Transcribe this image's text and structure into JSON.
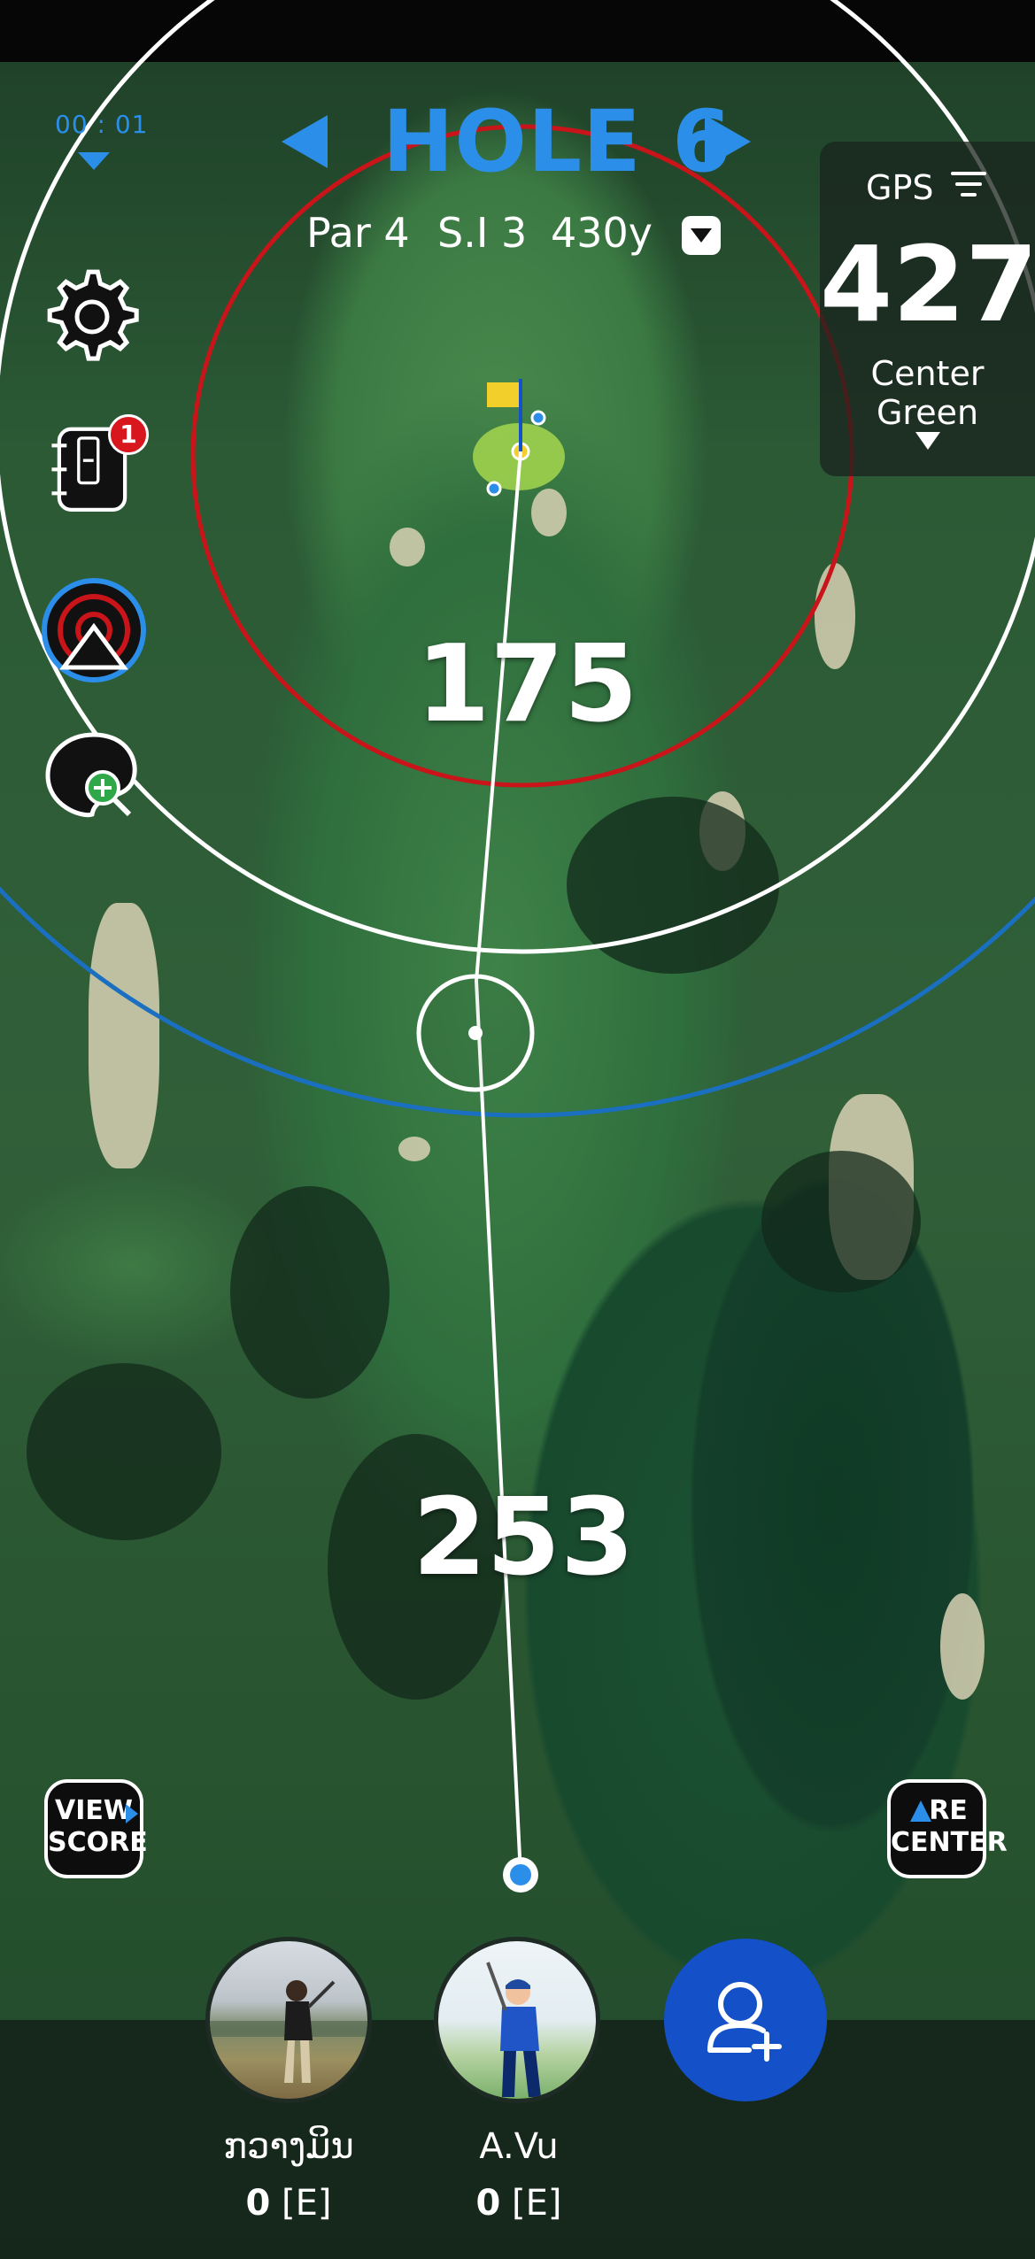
{
  "timer": {
    "value": "00 : 01"
  },
  "hole": {
    "title": "HOLE 6",
    "par": "Par 4",
    "stroke_index": "S.I 3",
    "yardage": "430y"
  },
  "gps": {
    "label": "GPS",
    "distance": "427",
    "target": "Center Green"
  },
  "sidebar": {
    "notes_badge": "1"
  },
  "map": {
    "distance_to_green": "175",
    "distance_from_tee": "253"
  },
  "buttons": {
    "view_score_line1": "VIEW",
    "view_score_line2": "SCORE",
    "recenter_line1": "RE",
    "recenter_line2": "CENTER"
  },
  "players": [
    {
      "name": "ກວາງມິນ",
      "score": "0",
      "to_par": "[E]"
    },
    {
      "name": "A.Vu",
      "score": "0",
      "to_par": "[E]"
    }
  ],
  "colors": {
    "accent": "#2b8ee8",
    "red_ring": "#c9141a",
    "blue_ring": "#1a6fc0",
    "add_player": "#1450c8"
  }
}
